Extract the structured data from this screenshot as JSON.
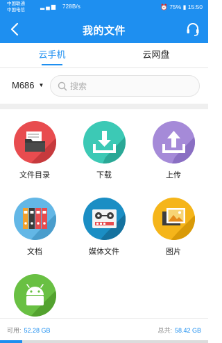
{
  "status_bar": {
    "carrier_1": "中国联通",
    "carrier_2": "中国电信",
    "speed": "728B/s",
    "battery": "75%",
    "time": "15:50"
  },
  "header": {
    "title": "我的文件"
  },
  "tabs": [
    {
      "label": "云手机",
      "active": true
    },
    {
      "label": "云网盘",
      "active": false
    }
  ],
  "device": {
    "name": "M686"
  },
  "search": {
    "placeholder": "搜索"
  },
  "categories": [
    {
      "label": "文件目录",
      "icon": "folder-files-icon",
      "color": "#e84c4f"
    },
    {
      "label": "下载",
      "icon": "download-icon",
      "color": "#3cc9b5"
    },
    {
      "label": "上传",
      "icon": "upload-icon",
      "color": "#a58ad8"
    },
    {
      "label": "文档",
      "icon": "binders-icon",
      "color": "#63b7e6"
    },
    {
      "label": "媒体文件",
      "icon": "tape-recorder-icon",
      "color": "#1b8ec4"
    },
    {
      "label": "图片",
      "icon": "pictures-icon",
      "color": "#f5b51a"
    },
    {
      "label": "",
      "icon": "android-app-icon",
      "color": "#69c043"
    }
  ],
  "storage": {
    "available_label": "可用:",
    "available_value": "52.28 GB",
    "total_label": "总共:",
    "total_value": "58.42 GB",
    "used_fraction": 0.105
  },
  "colors": {
    "primary": "#1e8ff0"
  }
}
